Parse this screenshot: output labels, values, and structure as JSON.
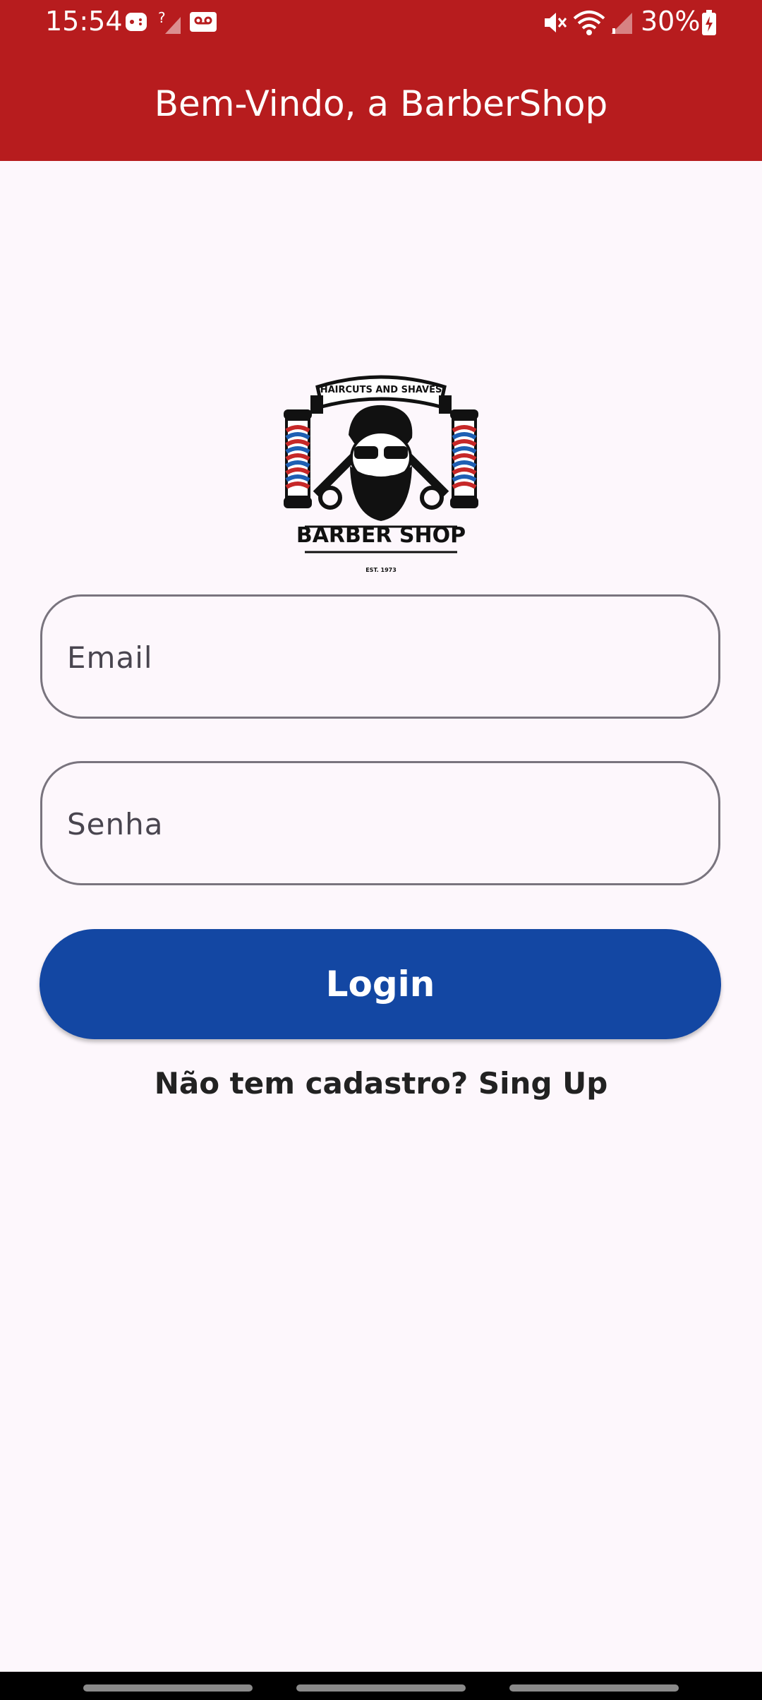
{
  "status_bar": {
    "time": "15:54",
    "battery": "30%",
    "icons": [
      "game-controller-icon",
      "signal-no-sim-icon",
      "voicemail-icon",
      "mute-icon",
      "wifi-icon",
      "cell-signal-icon",
      "battery-charging-icon"
    ]
  },
  "appbar": {
    "title": "Bem-Vindo, a BarberShop",
    "color": "#b71c1e"
  },
  "logo": {
    "banner": "HAIRCUTS AND SHAVES",
    "name": "BARBER SHOP",
    "est": "EST. 1973"
  },
  "form": {
    "email_placeholder": "Email",
    "password_placeholder": "Senha",
    "login_label": "Login",
    "login_color": "#1347a3",
    "signup_text": "Não tem cadastro? Sing Up"
  }
}
